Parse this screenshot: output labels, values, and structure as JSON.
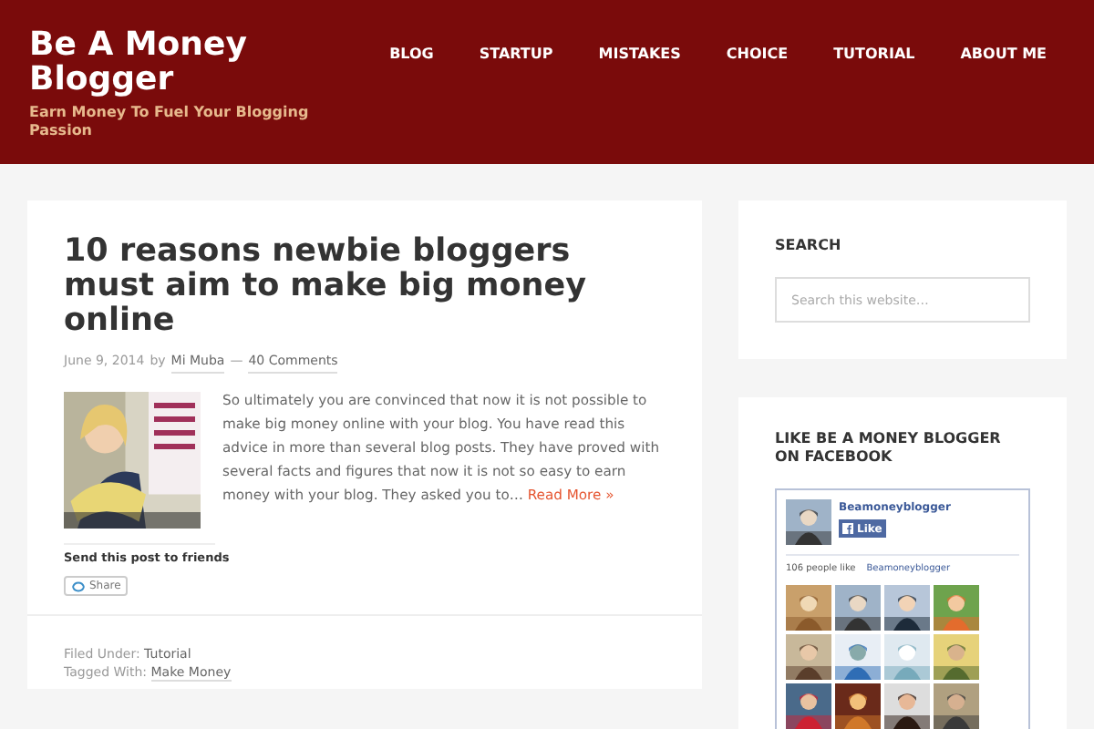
{
  "site": {
    "title": "Be A Money Blogger",
    "tagline": "Earn Money To Fuel Your Blogging Passion"
  },
  "nav": [
    {
      "label": "BLOG"
    },
    {
      "label": "STARTUP"
    },
    {
      "label": "MISTAKES"
    },
    {
      "label": "CHOICE"
    },
    {
      "label": "TUTORIAL"
    },
    {
      "label": "ABOUT ME"
    }
  ],
  "post": {
    "title": "10 reasons newbie bloggers must aim to make big money online",
    "date": "June 9, 2014",
    "by": "by",
    "author": "Mi Muba",
    "separator": "—",
    "comments": "40 Comments",
    "excerpt": "So ultimately you are convinced that now it is not possible to make big money online with your blog. You have read this advice in more than several blog posts. They have proved with several facts and figures that now it is not so easy to earn money with your blog. They asked you to…",
    "read_more": "Read More »",
    "share_heading": "Send this post to friends",
    "share_button": "Share",
    "filed_label": "Filed Under:",
    "filed_value": "Tutorial",
    "tagged_label": "Tagged With:",
    "tagged_value": "Make Money"
  },
  "sidebar": {
    "search": {
      "title": "SEARCH",
      "placeholder": "Search this website…"
    },
    "facebook": {
      "title": "LIKE BE A MONEY BLOGGER ON FACEBOOK",
      "page_name": "Beamoneyblogger",
      "like_button": "Like",
      "count_text": "106 people like",
      "count_link": "Beamoneyblogger"
    }
  }
}
